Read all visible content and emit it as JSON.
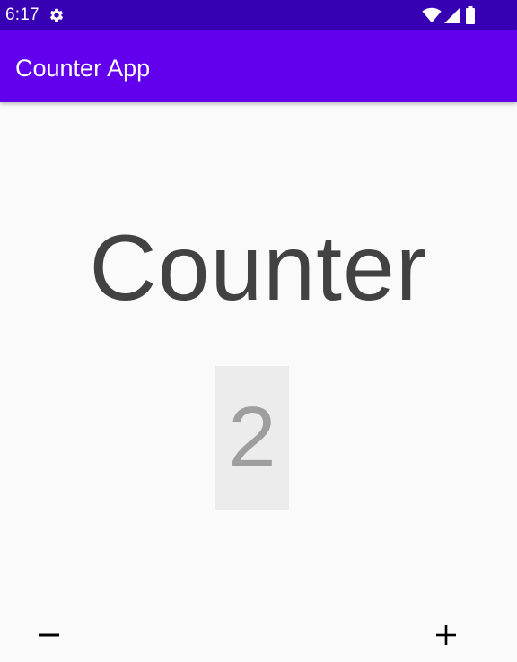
{
  "status_bar": {
    "time": "6:17",
    "icons": [
      "gear-icon",
      "wifi-icon",
      "cell-signal-icon",
      "battery-icon"
    ],
    "color": "#3700b3"
  },
  "app_bar": {
    "title": "Counter App",
    "color": "#6200ee"
  },
  "main": {
    "heading": "Counter",
    "value": "2"
  },
  "controls": {
    "decrement_icon": "minus-icon",
    "increment_icon": "plus-icon"
  }
}
